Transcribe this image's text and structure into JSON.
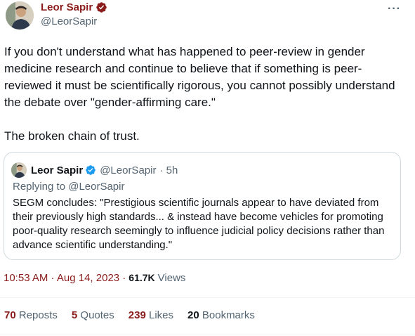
{
  "tweet": {
    "author_name": "Leor Sapir",
    "author_handle": "@LeorSapir",
    "more_icon": "more-horizontal-icon",
    "body_paragraphs": [
      "If you don't understand what has happened to peer-review in gender medicine research and continue to believe that if something is peer-reviewed it must be scientifically rigorous, you cannot possibly understand the debate over \"gender-affirming care.\"",
      "The broken chain of trust."
    ],
    "quote": {
      "author_name": "Leor Sapir",
      "author_handle": "@LeorSapir",
      "time": "· 5h",
      "replying": "Replying to @LeorSapir",
      "text": "SEGM concludes: \"Prestigious scientific journals appear to have deviated from their previously high standards... & instead have become vehicles for promoting poor-quality research seemingly to influence judicial policy decisions rather than advance scientific understanding.\""
    },
    "timestamp": "10:53 AM · Aug 14, 2023 ·",
    "views_count": "61.7K",
    "views_label": "Views",
    "stats": {
      "reposts_num": "70",
      "reposts_label": "Reposts",
      "quotes_num": "5",
      "quotes_label": "Quotes",
      "likes_num": "239",
      "likes_label": "Likes",
      "bookmarks_num": "20",
      "bookmarks_label": "Bookmarks"
    }
  },
  "colors": {
    "accent": "#8a1c1c",
    "verified": "#1d9bf0",
    "text": "#0f1419",
    "muted": "#536471",
    "border": "#cfd9de"
  }
}
